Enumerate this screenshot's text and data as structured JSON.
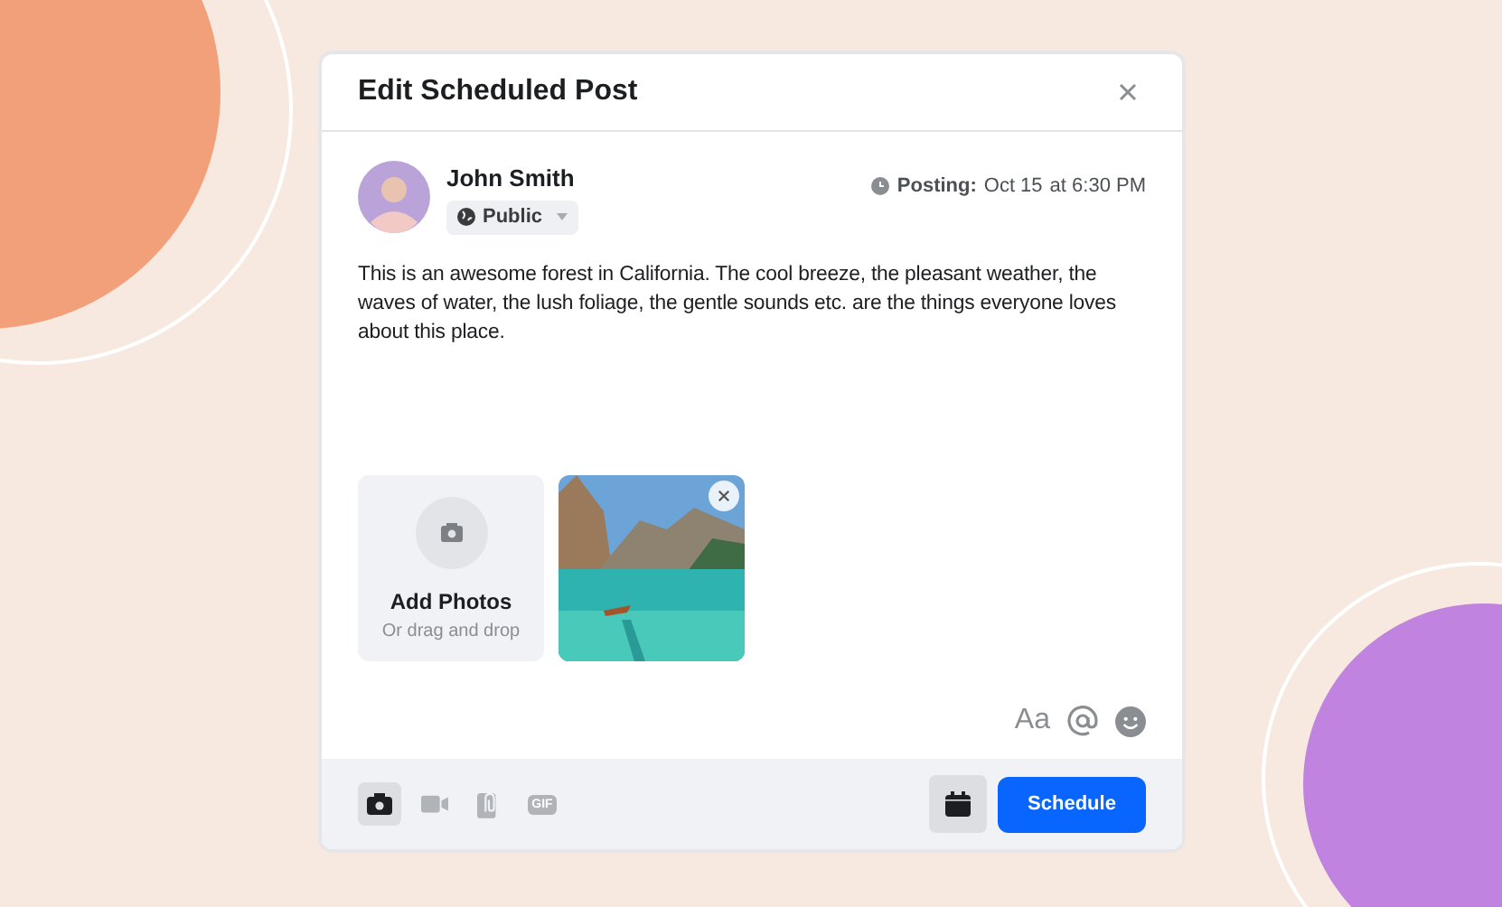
{
  "dialog": {
    "title": "Edit Scheduled Post"
  },
  "author": {
    "name": "John Smith",
    "audience": "Public"
  },
  "schedule": {
    "label": "Posting:",
    "date": "Oct 15",
    "time": "at 6:30 PM"
  },
  "post_text": "This is an awesome forest in California. The cool breeze, the pleasant weather, the waves of water, the lush foliage, the gentle sounds etc. are the things everyone loves about this place.",
  "add_photos": {
    "title": "Add Photos",
    "hint": "Or drag and drop"
  },
  "format_tools": [
    {
      "kind": "text",
      "label": "Aa"
    },
    {
      "kind": "mention"
    },
    {
      "kind": "emoji"
    }
  ],
  "media_tools": [
    {
      "kind": "camera",
      "selected": true
    },
    {
      "kind": "video",
      "selected": false
    },
    {
      "kind": "attach",
      "selected": false
    },
    {
      "kind": "gif",
      "label": "GIF",
      "selected": false
    }
  ],
  "buttons": {
    "schedule": "Schedule"
  }
}
